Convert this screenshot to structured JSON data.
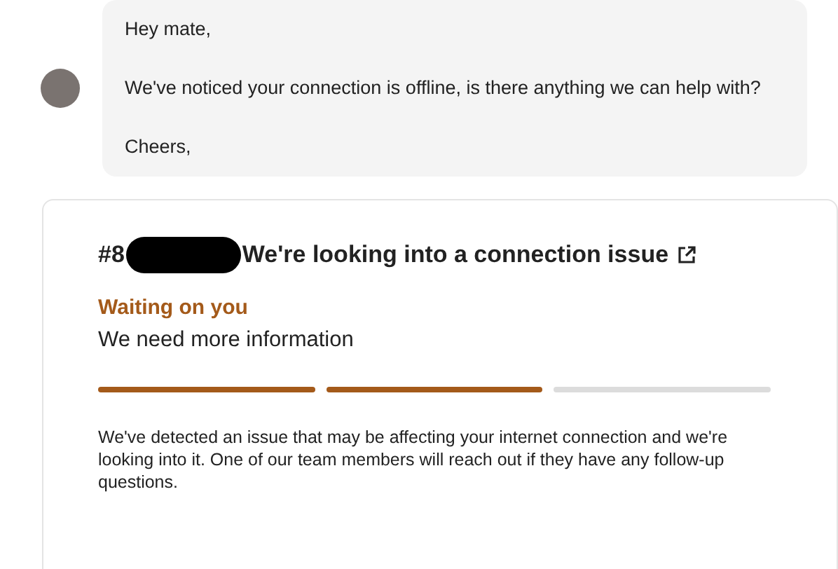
{
  "message": {
    "lines": [
      "Hey mate,",
      "We've noticed your connection is offline, is there anything we can help with?",
      "Cheers,"
    ]
  },
  "ticket": {
    "number": "#8",
    "title": "We're looking into a connection issue",
    "status": "Waiting on you",
    "status_detail": "We need more information",
    "steps": [
      {
        "done": true
      },
      {
        "done": true
      },
      {
        "done": false
      }
    ],
    "description": "We've detected an issue that may be affecting your internet connection and we're looking into it. One of our team members will reach out if they have any follow-up questions."
  }
}
